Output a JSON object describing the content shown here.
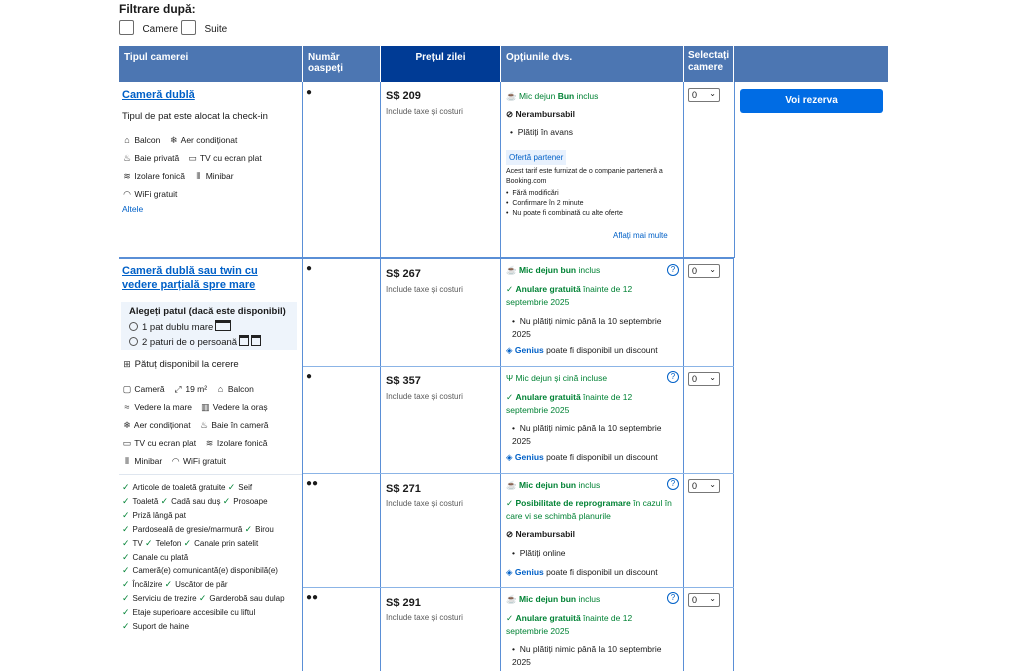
{
  "filter": {
    "title": "Filtrare după:",
    "options": [
      "Camere",
      "Suite"
    ]
  },
  "header": {
    "room_type": "Tipul camerei",
    "guests": "Număr oaspeți",
    "price": "Prețul zilei",
    "options": "Opțiunile dvs.",
    "select": "Selectați camere"
  },
  "reserve_button": "Voi rezerva",
  "room1": {
    "name": "Cameră dublă",
    "bed_note": "Tipul de pat este alocat la check-in",
    "amenities": [
      "Balcon",
      "Aer condiționat",
      "Baie privată",
      "TV cu ecran plat",
      "Izolare fonică",
      "Minibar",
      "WiFi gratuit"
    ],
    "more": "Altele",
    "offer": {
      "price": "S$ 209",
      "taxes": "Include taxe și costuri",
      "breakfast_pre": "Mic dejun ",
      "breakfast_bold": "Bun",
      "breakfast_post": " inclus",
      "refund": "Nerambursabil",
      "pay": "Plătiți în avans",
      "partner_badge": "Ofertă partener",
      "partner_text": "Acest tarif este furnizat de o companie parteneră a Booking.com",
      "partner_list": [
        "Fără modificări",
        "Confirmare în 2 minute",
        "Nu poate fi combinată cu alte oferte"
      ],
      "learn_more": "Aflați mai multe",
      "qty": "0"
    }
  },
  "room2": {
    "name": "Cameră dublă sau twin cu vedere parțială spre mare",
    "bed_choice_title": "Alegeți patul (dacă este disponibil)",
    "bed_options": [
      "1 pat dublu mare",
      "2 paturi de o persoană"
    ],
    "crib": "Pătuț disponibil la cerere",
    "amenities": [
      "Cameră",
      "19 m²",
      "Balcon",
      "Vedere la mare",
      "Vedere la oraș",
      "Aer condiționat",
      "Baie în cameră",
      "TV cu ecran plat",
      "Izolare fonică",
      "Minibar",
      "WiFi gratuit"
    ],
    "facilities": [
      "Articole de toaletă gratuite",
      "Seif",
      "Toaletă",
      "Cadă sau duș",
      "Prosoape",
      "Priză lângă pat",
      "Pardoseală de gresie/marmură",
      "Birou",
      "TV",
      "Telefon",
      "Canale prin satelit",
      "Canale cu plată",
      "Cameră(e) comunicantă(e) disponibilă(e)",
      "Încălzire",
      "Uscător de păr",
      "Serviciu de trezire",
      "Garderobă sau dulap",
      "Etaje superioare accesibile cu liftul",
      "Suport de haine"
    ],
    "offers": [
      {
        "price": "S$ 267",
        "taxes": "Include taxe și costuri",
        "meal_bold": "Mic dejun bun",
        "meal_post": " inclus",
        "cancel_bold": "Anulare gratuită",
        "cancel_post": " înainte de 12 septembrie 2025",
        "pay": "Nu plătiți nimic până la 10 septembrie 2025",
        "genius": "Genius",
        "genius_post": " poate fi disponibil un discount",
        "qty": "0"
      },
      {
        "price": "S$ 357",
        "taxes": "Include taxe și costuri",
        "meal": "Mic dejun și cină incluse",
        "cancel_bold": "Anulare gratuită",
        "cancel_post": " înainte de 12 septembrie 2025",
        "pay": "Nu plătiți nimic până la 10 septembrie 2025",
        "genius": "Genius",
        "genius_post": " poate fi disponibil un discount",
        "qty": "0"
      },
      {
        "price": "S$ 271",
        "taxes": "Include taxe și costuri",
        "meal_bold": "Mic dejun bun",
        "meal_post": " inclus",
        "resched_bold": "Posibilitate de reprogramare",
        "resched_post": " în cazul în care vi se schimbă planurile",
        "refund": "Nerambursabil",
        "pay": "Plătiți online",
        "genius": "Genius",
        "genius_post": " poate fi disponibil un discount",
        "qty": "0"
      },
      {
        "price": "S$ 291",
        "taxes": "Include taxe și costuri",
        "meal_bold": "Mic dejun bun",
        "meal_post": " inclus",
        "cancel_bold": "Anulare gratuită",
        "cancel_post": " înainte de 12 septembrie 2025",
        "pay": "Nu plătiți nimic până la 10 septembrie 2025",
        "qty": "0"
      }
    ]
  }
}
